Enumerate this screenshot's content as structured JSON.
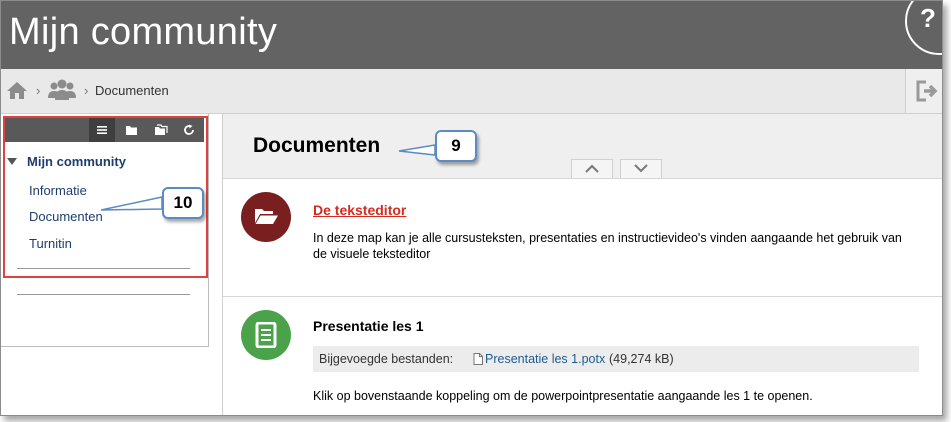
{
  "header": {
    "title": "Mijn community",
    "help_label": "?"
  },
  "breadcrumb": {
    "separator": "›",
    "current": "Documenten"
  },
  "sidebar": {
    "tree_title": "Mijn community",
    "items": [
      {
        "label": "Informatie"
      },
      {
        "label": "Documenten"
      },
      {
        "label": "Turnitin"
      }
    ]
  },
  "main": {
    "page_title": "Documenten",
    "items": [
      {
        "title": "De teksteditor",
        "description": "In deze map kan je alle cursusteksten, presentaties en instructievideo's vinden aangaande het gebruik van de visuele teksteditor",
        "icon": "folder-open-icon",
        "icon_bg": "#7a1f1f"
      },
      {
        "title": "Presentatie les 1",
        "attachment_label": "Bijgevoegde bestanden:",
        "attachment_name": "Presentatie les 1.potx",
        "attachment_size": "(49,274 kB)",
        "description": "Klik op bovenstaande koppeling om de powerpointpresentatie aangaande les 1 te openen.",
        "icon": "document-icon",
        "icon_bg": "#4aa24a"
      }
    ]
  },
  "callouts": {
    "page_title_callout": "9",
    "sidebar_callout": "10"
  },
  "colors": {
    "header_bg": "#636363",
    "link_red": "#d52b1e",
    "link_blue": "#1d3e6d",
    "highlight_red": "#e0413d",
    "callout_border": "#5b8bc4"
  }
}
